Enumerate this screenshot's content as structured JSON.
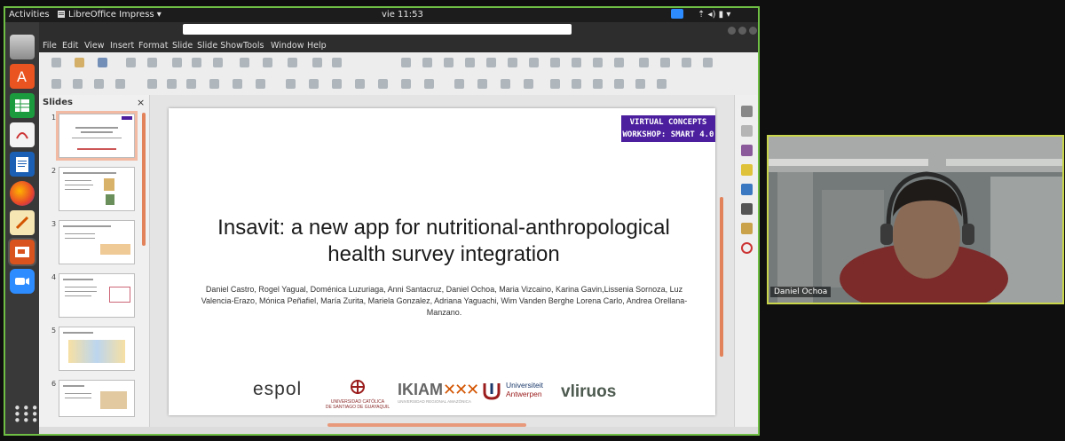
{
  "topbar": {
    "activities": "Activities",
    "app_menu": "LibreOffice Impress ▾",
    "clock": "vie 11:53",
    "status_icons": "⇡ ◂) ▮ ▾"
  },
  "menubar": [
    "File",
    "Edit",
    "View",
    "Insert",
    "Format",
    "Slide",
    "Slide Show",
    "Tools",
    "Window",
    "Help"
  ],
  "slides_panel": {
    "title": "Slides",
    "close": "×",
    "slide_numbers": [
      "1",
      "2",
      "3",
      "4",
      "5",
      "6"
    ]
  },
  "slide": {
    "badge_line1": "VIRTUAL CONCEPTS",
    "badge_line2": "WORKSHOP: SMART 4.0",
    "title": "Insavit: a new app for nutritional-anthropological health survey integration",
    "authors": "Daniel Castro, Rogel Yagual, Doménica Luzuriaga, Anni Santacruz, Daniel Ochoa, Maria Vizcaino, Karina Gavin,Lissenia Sornoza, Luz Valencia-Erazo, Mónica Peñafiel, María Zurita, Mariela Gonzalez, Adriana Yaguachi, Wim Vanden Berghe Lorena Carlo, Andrea Orellana-Manzano.",
    "logos": {
      "espol": "espol",
      "ucsg_line1": "UNIVERSIDAD CATÓLICA",
      "ucsg_line2": "DE SANTIAGO DE GUAYAQUIL",
      "ikiam": "IKIAM",
      "ikiam_sub": "UNIVERSIDAD REGIONAL AMAZÓNICA",
      "antwerpen_line1": "Universiteit",
      "antwerpen_line2": "Antwerpen",
      "vliruos": "vliruos"
    }
  },
  "webcam": {
    "participant_name": "Daniel Ochoa"
  },
  "colors": {
    "frame_green": "#6fbf45",
    "webcam_border": "#c9d64a",
    "badge_purple": "#4b1f9e",
    "accent_orange": "#e2825a"
  }
}
